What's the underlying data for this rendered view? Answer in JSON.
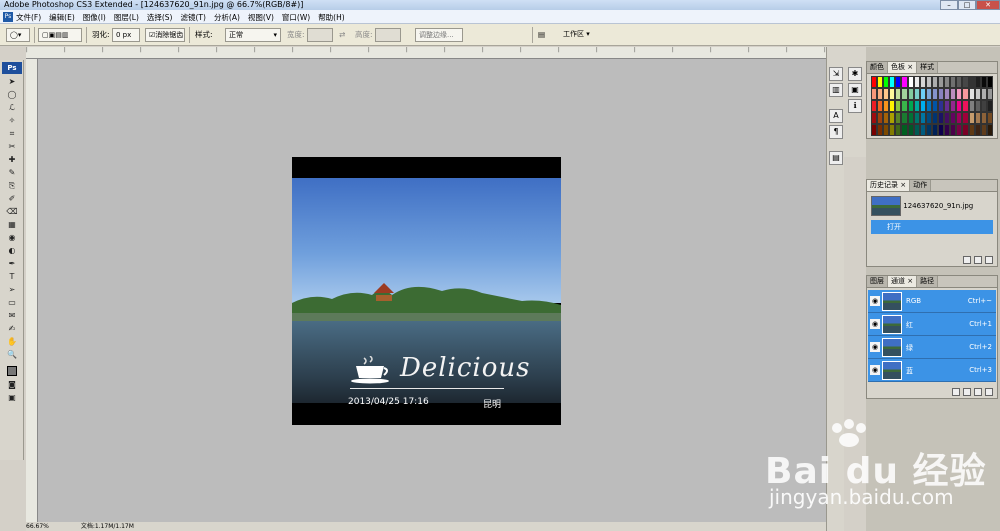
{
  "window": {
    "title": "Adobe Photoshop CS3 Extended - [124637620_91n.jpg @ 66.7%(RGB/8#)]"
  },
  "menu": [
    "文件(F)",
    "编辑(E)",
    "图像(I)",
    "图层(L)",
    "选择(S)",
    "滤镜(T)",
    "分析(A)",
    "视图(V)",
    "窗口(W)",
    "帮助(H)"
  ],
  "options": {
    "feather_label": "羽化:",
    "feather_value": "0 px",
    "antialias_label": "消除锯齿",
    "style_label": "样式:",
    "style_value": "正常",
    "width_label": "宽度:",
    "height_label": "高度:",
    "refine_edge": "调整边缘...",
    "workspace": "工作区 ▾"
  },
  "toolbox": {
    "badge": "Ps",
    "tools": [
      "move-icon",
      "marquee-icon",
      "lasso-icon",
      "magic-wand-icon",
      "crop-icon",
      "slice-icon",
      "healing-icon",
      "brush-icon",
      "stamp-icon",
      "history-brush-icon",
      "eraser-icon",
      "gradient-icon",
      "blur-icon",
      "dodge-icon",
      "pen-icon",
      "type-icon",
      "path-select-icon",
      "shape-icon",
      "notes-icon",
      "eyedropper-icon",
      "hand-icon",
      "zoom-icon"
    ],
    "glyphs": [
      "➤",
      "◯",
      "ℒ",
      "✧",
      "⌗",
      "✂",
      "✚",
      "✎",
      "⎘",
      "✐",
      "⌫",
      "▦",
      "◉",
      "◐",
      "✒",
      "T",
      "➢",
      "▭",
      "✉",
      "✍",
      "✋",
      "🔍"
    ]
  },
  "canvas": {
    "photo_title": "Delicious",
    "datestamp": "2013/04/25  17:16",
    "place": "昆明"
  },
  "swatches_panel": {
    "tabs": [
      "颜色",
      "色板 ×",
      "样式"
    ],
    "active": 1
  },
  "swatch_colors": [
    "#ff0000",
    "#ffff00",
    "#00ff00",
    "#00ffff",
    "#0000ff",
    "#ff00ff",
    "#ffffff",
    "#ebebeb",
    "#d6d6d6",
    "#c2c2c2",
    "#adadad",
    "#999999",
    "#858585",
    "#707070",
    "#5c5c5c",
    "#474747",
    "#333333",
    "#1f1f1f",
    "#0a0a0a",
    "#000000",
    "#f7977a",
    "#f9ad81",
    "#fdc68a",
    "#fff79a",
    "#c4df9b",
    "#a2d39c",
    "#82ca9d",
    "#7bcdc8",
    "#6ecff6",
    "#7ea7d8",
    "#8493ca",
    "#8882be",
    "#a187be",
    "#bc8dbf",
    "#f49ac2",
    "#f6989d",
    "#e0e0e0",
    "#c8c8c8",
    "#b0b0b0",
    "#989898",
    "#ed1c24",
    "#f26522",
    "#f7941d",
    "#fff200",
    "#8dc63f",
    "#39b54a",
    "#00a651",
    "#00a99d",
    "#00aeef",
    "#0072bc",
    "#0054a6",
    "#2e3192",
    "#662d91",
    "#92278f",
    "#ec008c",
    "#ed145b",
    "#808080",
    "#606060",
    "#404040",
    "#202020",
    "#9e0b0f",
    "#a0410d",
    "#a36209",
    "#aba000",
    "#598527",
    "#1a7b30",
    "#007236",
    "#00746b",
    "#0076a3",
    "#004b80",
    "#003471",
    "#1b1464",
    "#440e62",
    "#630460",
    "#9e005d",
    "#9e0039",
    "#c69c6d",
    "#a67c52",
    "#8c6239",
    "#754c24",
    "#790000",
    "#7b2e00",
    "#7d4900",
    "#827b00",
    "#406618",
    "#005e20",
    "#005826",
    "#005952",
    "#005b7f",
    "#003663",
    "#002157",
    "#0d004c",
    "#32004b",
    "#4b0049",
    "#7b0046",
    "#7a0026",
    "#603913",
    "#3c2415",
    "#5f3c1b",
    "#2a1a0a"
  ],
  "history_panel": {
    "tabs": [
      "历史记录 ×",
      "动作"
    ],
    "active": 0,
    "snapshot": "124637620_91n.jpg",
    "step": "打开"
  },
  "channels_panel": {
    "tabs": [
      "图层",
      "通道 ×",
      "路径"
    ],
    "active": 1,
    "rows": [
      {
        "name": "RGB",
        "shortcut": "Ctrl+~"
      },
      {
        "name": "红",
        "shortcut": "Ctrl+1"
      },
      {
        "name": "绿",
        "shortcut": "Ctrl+2"
      },
      {
        "name": "蓝",
        "shortcut": "Ctrl+3"
      }
    ]
  },
  "status": {
    "zoom": "66.67%",
    "doc": "文档:1.17M/1.17M"
  },
  "watermark": {
    "logo": "Bai du 经验",
    "url": "jingyan.baidu.com"
  }
}
